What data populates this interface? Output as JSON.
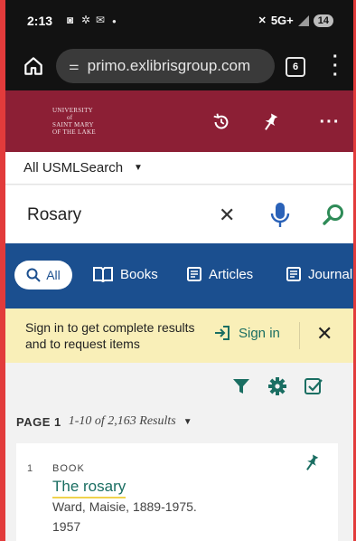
{
  "status_bar": {
    "time": "2:13",
    "icons_left": [
      "cast-icon",
      "asterisk-icon",
      "mail-icon",
      "dot"
    ],
    "network": "5G+",
    "battery": "14"
  },
  "browser": {
    "url": "primo.exlibrisgroup.com",
    "tab_count": "6"
  },
  "header": {
    "logo_lines": [
      "UNIVERSITY",
      "of",
      "SAINT MARY",
      "OF THE LAKE"
    ],
    "brand_color": "#8c1f35"
  },
  "scope": {
    "label": "All USMLSearch"
  },
  "search": {
    "value": "Rosary"
  },
  "tabs": [
    {
      "label": "All"
    },
    {
      "label": "Books"
    },
    {
      "label": "Articles"
    },
    {
      "label": "Journal"
    }
  ],
  "banner": {
    "message": "Sign in to get complete results and to request items",
    "signin_label": "Sign in"
  },
  "results_info": {
    "page_label": "PAGE 1",
    "range": "1-10 of 2,163 Results"
  },
  "results": [
    {
      "number": "1",
      "type": "BOOK",
      "title": "The rosary",
      "author": "Ward, Maisie, 1889-1975.",
      "year": "1957"
    }
  ],
  "colors": {
    "accent_teal": "#1a6e62",
    "tab_blue": "#1b4f8f",
    "banner_yellow": "#f9efb8"
  }
}
